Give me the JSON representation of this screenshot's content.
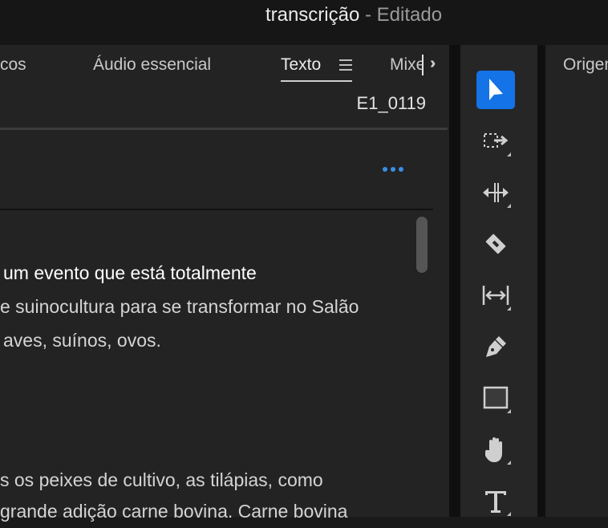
{
  "window": {
    "title": "transcrição",
    "title_suffix": "- Editado"
  },
  "tabs": [
    {
      "label": "cos"
    },
    {
      "label": "Áudio essencial"
    },
    {
      "label": "Texto",
      "active": true
    },
    {
      "label": "Mixe"
    }
  ],
  "source_tab": {
    "label": "Origem"
  },
  "panel": {
    "clip_name": "E1_0119"
  },
  "transcript": [
    {
      "text": "um evento que está totalmente",
      "active": true
    },
    {
      "text": "e suinocultura para se transformar no Salão",
      "active": false
    },
    {
      "text": "aves, suínos, ovos.",
      "active": false
    },
    {
      "text": "s os peixes de cultivo, as tilápias, como",
      "active": false
    },
    {
      "text": "grande adição carne bovina. Carne bovina",
      "active": false
    }
  ],
  "tools": [
    {
      "name": "selection-tool",
      "icon": "arrow-pointer-icon",
      "selected": true
    },
    {
      "name": "track-select-forward-tool",
      "icon": "track-select-icon"
    },
    {
      "name": "ripple-edit-tool",
      "icon": "ripple-edit-icon"
    },
    {
      "name": "razor-tool",
      "icon": "razor-icon"
    },
    {
      "name": "slip-tool",
      "icon": "slip-icon"
    },
    {
      "name": "pen-tool",
      "icon": "pen-icon"
    },
    {
      "name": "rectangle-tool",
      "icon": "rectangle-icon"
    },
    {
      "name": "hand-tool",
      "icon": "hand-icon"
    },
    {
      "name": "type-tool",
      "icon": "type-icon"
    }
  ],
  "colors": {
    "accent": "#1473e6",
    "more_dots": "#3a8ee6",
    "panel_bg": "#232323",
    "window_bg": "#161616"
  }
}
